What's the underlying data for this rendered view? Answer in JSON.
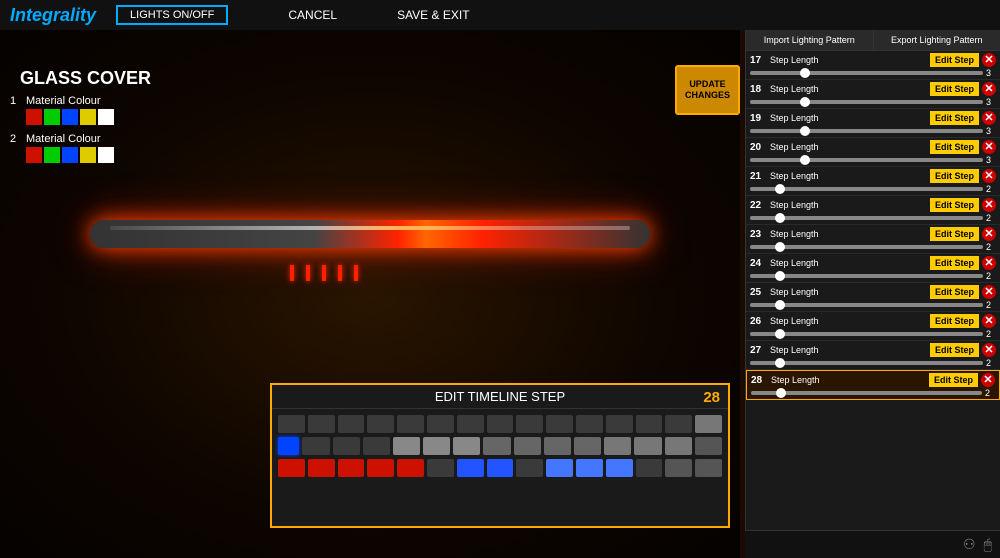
{
  "header": {
    "logo": "Integrality",
    "lights_btn": "LIGHTS ON/OFF",
    "cancel_btn": "CANCEL",
    "save_btn": "SAVE & EXIT"
  },
  "main": {
    "glass_cover_label": "GLASS COVER",
    "material1_label": "Material Colour",
    "material2_label": "Material Colour",
    "update_btn": "UPDATE\nCHANGES"
  },
  "right_panel": {
    "import_btn": "Import Lighting Pattern",
    "export_btn": "Export Lighting Pattern",
    "steps": [
      {
        "num": 17,
        "label": "Step Length",
        "edit": "Edit Step",
        "val": 3
      },
      {
        "num": 18,
        "label": "Step Length",
        "edit": "Edit Step",
        "val": 3
      },
      {
        "num": 19,
        "label": "Step Length",
        "edit": "Edit Step",
        "val": 3
      },
      {
        "num": 20,
        "label": "Step Length",
        "edit": "Edit Step",
        "val": 3
      },
      {
        "num": 21,
        "label": "Step Length",
        "edit": "Edit Step",
        "val": 2
      },
      {
        "num": 22,
        "label": "Step Length",
        "edit": "Edit Step",
        "val": 2
      },
      {
        "num": 23,
        "label": "Step Length",
        "edit": "Edit Step",
        "val": 2
      },
      {
        "num": 24,
        "label": "Step Length",
        "edit": "Edit Step",
        "val": 2
      },
      {
        "num": 25,
        "label": "Step Length",
        "edit": "Edit Step",
        "val": 2
      },
      {
        "num": 26,
        "label": "Step Length",
        "edit": "Edit Step",
        "val": 2
      },
      {
        "num": 27,
        "label": "Step Length",
        "edit": "Edit Step",
        "val": 2
      },
      {
        "num": 28,
        "label": "Step Length",
        "edit": "Edit Step",
        "val": 2,
        "highlighted": true
      }
    ]
  },
  "timeline": {
    "header": "EDIT TIMELINE STEP",
    "step_num": 28
  },
  "colors": {
    "accent": "#ffaa00",
    "highlight": "#00aaff",
    "delete": "#cc0000",
    "edit_btn": "#ffcc00"
  }
}
